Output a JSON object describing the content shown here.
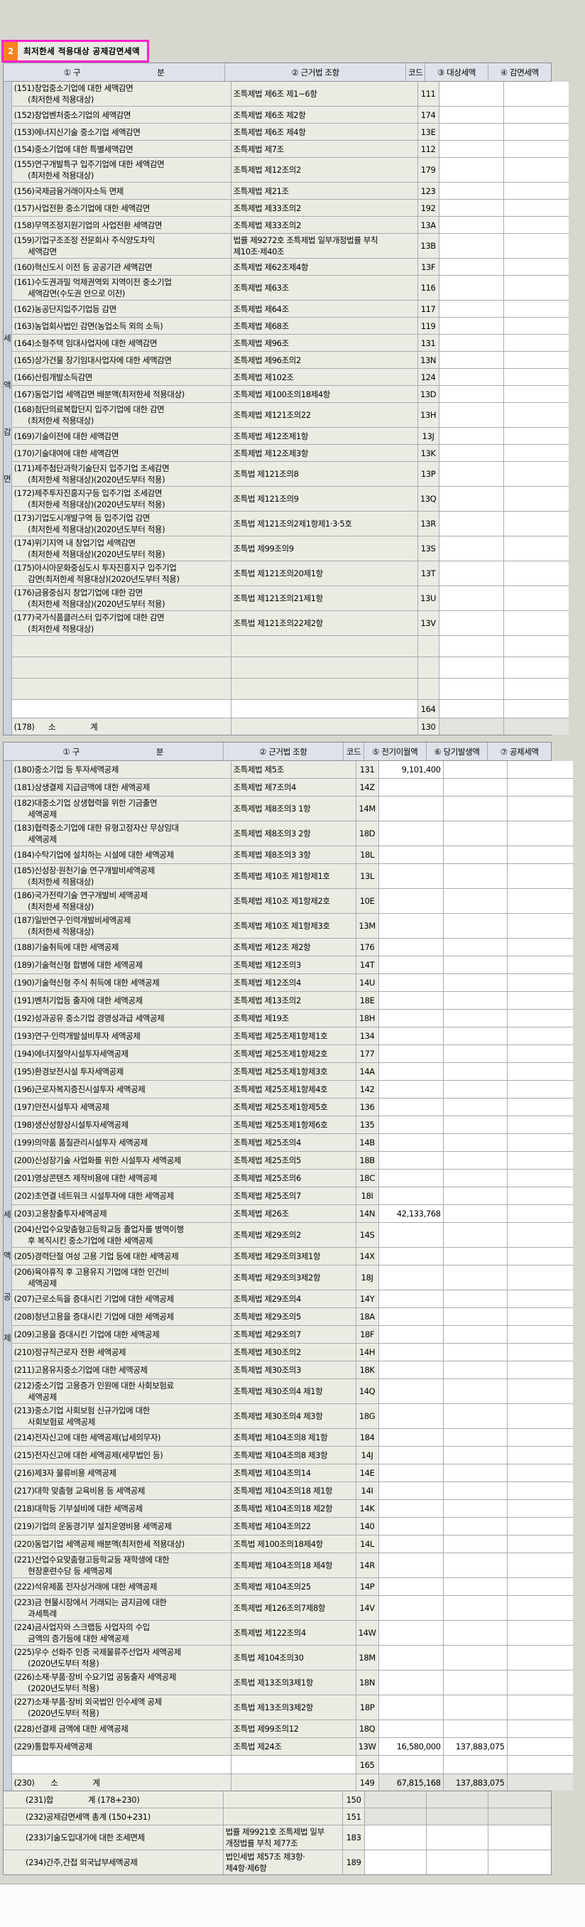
{
  "title": {
    "number": "2",
    "text": "최저한세 적용대상 공제감면세액"
  },
  "table1": {
    "side_label": "세액감면",
    "headers": {
      "col1_left": "① 구",
      "col1_right": "분",
      "col2": "② 근거법 조항",
      "code": "코드",
      "v1": "③ 대상세액",
      "v2": "④ 감면세액"
    },
    "rows": [
      {
        "label": "(151)창업중소기업에 대한 세액감면\n      (최저한세 적용대상)",
        "basis": "조특제법 제6조 제1~6항",
        "code": "111",
        "h2": true
      },
      {
        "label": "(152)창업벤처중소기업의 세액감면",
        "basis": "조특제법 제6조 제2항",
        "code": "174"
      },
      {
        "label": "(153)에너지신기술 중소기업 세액감면",
        "basis": "조특제법 제6조 제4항",
        "code": "13E"
      },
      {
        "label": "(154)중소기업에 대한 특별세액감면",
        "basis": "조특제법 제7조",
        "code": "112"
      },
      {
        "label": "(155)연구개발특구 입주기업에 대한 세액감면\n      (최저한세 적용대상)",
        "basis": "조특제법 제12조의2",
        "code": "179",
        "h2": true
      },
      {
        "label": "(156)국제금융거래이자소득 면제",
        "basis": "조특제법 제21조",
        "code": "123"
      },
      {
        "label": "(157)사업전환 중소기업에 대한 세액감면",
        "basis": "조특제법 제33조의2",
        "code": "192"
      },
      {
        "label": "(158)무역조정지원기업의 사업전환 세액감면",
        "basis": "조특제법 제33조의2",
        "code": "13A"
      },
      {
        "label": "(159)기업구조조정 전문회사 주식양도차익\n      세액감면",
        "basis": "법률 제9272호 조특제법 일부개정법률 부칙\n제10조·제40조",
        "code": "13B",
        "h2": true
      },
      {
        "label": "(160)혁신도시 이전 등 공공기관 세액감면",
        "basis": "조특제법 제62조제4항",
        "code": "13F"
      },
      {
        "label": "(161)수도권과밀 억제권역외 지역이전 중소기업\n      세액감면(수도권 안으로 이전)",
        "basis": "조특제법 제63조",
        "code": "116",
        "h2": true
      },
      {
        "label": "(162)농공단지입주기업등 감면",
        "basis": "조특제법 제64조",
        "code": "117"
      },
      {
        "label": "(163)농업회사법인 감면(농업소득 외의 소득)",
        "basis": "조특제법 제68조",
        "code": "119"
      },
      {
        "label": "(164)소형주택 임대사업자에 대한 세액감면",
        "basis": "조특제법 제96조",
        "code": "131"
      },
      {
        "label": "(165)상가건물 장기임대사업자에 대한 세액감면",
        "basis": "조특제법 제96조의2",
        "code": "13N"
      },
      {
        "label": "(166)산림개발소득감면",
        "basis": "조특제법 제102조",
        "code": "124"
      },
      {
        "label": "(167)동업기업 세액감면 배분액(최저한세 적용대상)",
        "basis": "조특제법 제100조의18제4항",
        "code": "13D"
      },
      {
        "label": "(168)첨단의료복합단지 입주기업에 대한 감면\n      (최저한세 적용대상)",
        "basis": "조특제법 제121조의22",
        "code": "13H",
        "h2": true
      },
      {
        "label": "(169)기술이전에 대한 세액감면",
        "basis": "조특제법 제12조제1항",
        "code": "13J"
      },
      {
        "label": "(170)기술대여에 대한 세액감면",
        "basis": "조특제법 제12조제3항",
        "code": "13K"
      },
      {
        "label": "(171)제주첨단과학기술단지 입주기업 조세감면\n      (최저한세 적용대상)(2020년도부터 적용)",
        "basis": "조특법 제121조의8",
        "code": "13P",
        "h2": true
      },
      {
        "label": "(172)제주투자진흥지구등 입주기업 조세감면\n      (최저한세 적용대상)(2020년도부터 적용)",
        "basis": "조특법 제121조의9",
        "code": "13Q",
        "h2": true
      },
      {
        "label": "(173)기업도시개발구역 등 입주기업 감면\n      (최저한세 적용대상)(2020년도부터 적용)",
        "basis": "조특법 제121조의2제1항제1·3·5호",
        "code": "13R",
        "h2": true
      },
      {
        "label": "(174)위기지역 내 창업기업 세액감면\n      (최저한세 적용대상)(2020년도부터 적용)",
        "basis": "조특법 제99조의9",
        "code": "13S",
        "h2": true
      },
      {
        "label": "(175)아시아문화중심도시 투자진흥지구 입주기업\n      감면(최저한세 적용대상)(2020년도부터 적용)",
        "basis": "조특법 제121조의20제1항",
        "code": "13T",
        "h2": true
      },
      {
        "label": "(176)금융중심지 창업기업에 대한 감면\n      (최저한세 적용대상)(2020년도부터 적용)",
        "basis": "조특법 제121조의21제1항",
        "code": "13U",
        "h2": true
      },
      {
        "label": "(177)국가식품클러스터 입주기업에 대한 감면\n      (최저한세 적용대상)",
        "basis": "조특법 제121조의22제2항",
        "code": "13V",
        "h2": true
      },
      {
        "type": "spacer"
      },
      {
        "type": "spacer"
      },
      {
        "type": "spacer"
      },
      {
        "type": "code_only",
        "code": "164"
      },
      {
        "type": "subtotal",
        "label": "(178)      소               계",
        "code": "130"
      }
    ]
  },
  "table2": {
    "side_label": "세액공제",
    "headers": {
      "col1_left": "① 구",
      "col1_right": "분",
      "col2": "② 근거법 조항",
      "code": "코드",
      "v1": "⑤ 전기이월액",
      "v2": "⑥ 당기발생액",
      "v3": "⑦ 공제세액"
    },
    "rows": [
      {
        "label": "(180)중소기업 등 투자세액공제",
        "basis": "조특제법 제5조",
        "code": "131",
        "v1": "9,101,400"
      },
      {
        "label": "(181)상생결제 지급금액에 대한 세액공제",
        "basis": "조특제법 제7조의4",
        "code": "14Z"
      },
      {
        "label": "(182)대중소기업 상생협력을 위한 기금출연\n      세액공제",
        "basis": "조특제법 제8조의3 1항",
        "code": "14M",
        "h2": true
      },
      {
        "label": "(183)협력중소기업에 대한 유형고정자산 무상임대\n      세액공제",
        "basis": "조특제법 제8조의3 2항",
        "code": "18D",
        "h2": true
      },
      {
        "label": "(184)수탁기업에 설치하는 시설에 대한 세액공제",
        "basis": "조특제법 제8조의3 3항",
        "code": "18L"
      },
      {
        "label": "(185)신성장·원천기술 연구개발비세액공제\n      (최저한세 적용대상)",
        "basis": "조특제법 제10조 제1항제1호",
        "code": "13L",
        "h2": true
      },
      {
        "label": "(186)국가전략기술 연구개발비 세액공제\n      (최저한세 적용대상)",
        "basis": "조특제법 제10조 제1항제2호",
        "code": "10E",
        "h2": true
      },
      {
        "label": "(187)일반연구·인력개발비세액공제\n      (최저한세 적용대상)",
        "basis": "조특제법 제10조 제1항제3호",
        "code": "13M",
        "h2": true
      },
      {
        "label": "(188)기술취득에 대한 세액공제",
        "basis": "조특제법 제12조 제2항",
        "code": "176"
      },
      {
        "label": "(189)기술혁신형 합병에 대한 세액공제",
        "basis": "조특제법 제12조의3",
        "code": "14T"
      },
      {
        "label": "(190)기술혁신형 주식 취득에 대한 세액공제",
        "basis": "조특제법 제12조의4",
        "code": "14U"
      },
      {
        "label": "(191)벤처기업등 출자에 대한 세액공제",
        "basis": "조특제법 제13조의2",
        "code": "18E"
      },
      {
        "label": "(192)성과공유 중소기업 경영성과급 세액공제",
        "basis": "조특제법 제19조",
        "code": "18H"
      },
      {
        "label": "(193)연구·인력개발설비투자 세액공제",
        "basis": "조특제법 제25조제1항제1호",
        "code": "134"
      },
      {
        "label": "(194)에너지절약시설투자세액공제",
        "basis": "조특제법 제25조제1항제2호",
        "code": "177"
      },
      {
        "label": "(195)환경보전시설 투자세액공제",
        "basis": "조특제법 제25조제1항제3호",
        "code": "14A"
      },
      {
        "label": "(196)근로자복지증진시설투자 세액공제",
        "basis": "조특제법 제25조제1항제4호",
        "code": "142"
      },
      {
        "label": "(197)안전시설투자 세액공제",
        "basis": "조특제법 제25조제1항제5호",
        "code": "136"
      },
      {
        "label": "(198)생산성향상시설투자세액공제",
        "basis": "조특제법 제25조제1항제6호",
        "code": "135"
      },
      {
        "label": "(199)의약품 품질관리시설투자 세액공제",
        "basis": "조특제법 제25조의4",
        "code": "14B"
      },
      {
        "label": "(200)신성장기술 사업화를 위한 시설투자 세액공제",
        "basis": "조특제법 제25조의5",
        "code": "18B"
      },
      {
        "label": "(201)영상콘텐츠 제작비용에 대한 세액공제",
        "basis": "조특제법 제25조의6",
        "code": "18C"
      },
      {
        "label": "(202)초연결 네트워크 시설투자에 대한 세액공제",
        "basis": "조특제법 제25조의7",
        "code": "18I"
      },
      {
        "label": "(203)고용창출투자세액공제",
        "basis": "조특제법 제26조",
        "code": "14N",
        "v1": "42,133,768"
      },
      {
        "label": "(204)산업수요맞춤형고등학교등 졸업자를 병역이행\n      후 복직시킨 중소기업에 대한 세액공제",
        "basis": "조특제법 제29조의2",
        "code": "14S",
        "h2": true
      },
      {
        "label": "(205)경력단절 여성 고용 기업 등에 대한 세액공제",
        "basis": "조특제법 제29조의3제1항",
        "code": "14X"
      },
      {
        "label": "(206)육아휴직 후 고용유지 기업에 대한 인건비\n      세액공제",
        "basis": "조특제법 제29조의3제2항",
        "code": "18J",
        "h2": true
      },
      {
        "label": "(207)근로소득을 증대시킨 기업에 대한 세액공제",
        "basis": "조특제법 제29조의4",
        "code": "14Y"
      },
      {
        "label": "(208)청년고용을 증대시킨 기업에 대한 세액공제",
        "basis": "조특제법 제29조의5",
        "code": "18A"
      },
      {
        "label": "(209)고용을 증대시킨 기업에 대한 세액공제",
        "basis": "조특제법 제29조의7",
        "code": "18F"
      },
      {
        "label": "(210)정규직근로자 전환 세액공제",
        "basis": "조특제법 제30조의2",
        "code": "14H"
      },
      {
        "label": "(211)고용유지중소기업에 대한 세액공제",
        "basis": "조특제법 제30조의3",
        "code": "18K"
      },
      {
        "label": "(212)중소기업 고용증가 인원에 대한 사회보험료\n      세액공제",
        "basis": "조특제법 제30조의4 제1항",
        "code": "14Q",
        "h2": true
      },
      {
        "label": "(213)중소기업 사회보험 신규가입에 대한\n      사회보험료 세액공제",
        "basis": "조특제법 제30조의4 제3항",
        "code": "18G",
        "h2": true
      },
      {
        "label": "(214)전자신고에 대한 세액공제(납세의무자)",
        "basis": "조특제법 제104조의8 제1항",
        "code": "184"
      },
      {
        "label": "(215)전자신고에 대한 세액공제(세무법인 등)",
        "basis": "조특제법 제104조의8 제3항",
        "code": "14J"
      },
      {
        "label": "(216)제3자 물류비용 세액공제",
        "basis": "조특제법 제104조의14",
        "code": "14E"
      },
      {
        "label": "(217)대학 맞춤형 교육비용 등 세액공제",
        "basis": "조특제법 제104조의18 제1항",
        "code": "14I"
      },
      {
        "label": "(218)대학등 기부설비에 대한 세액공제",
        "basis": "조특제법 제104조의18 제2항",
        "code": "14K"
      },
      {
        "label": "(219)기업의 운동경기부 설치운영비용 세액공제",
        "basis": "조특제법 제104조의22",
        "code": "140"
      },
      {
        "label": "(220)동업기업 세액공제 배분액(최저한세 적용대상)",
        "basis": "조특법 제100조의18제4항",
        "code": "14L"
      },
      {
        "label": "(221)산업수요맞춤형고등학교등 재학생에 대한\n      현장훈련수당 등 세액공제",
        "basis": "조특제법 제104조의18 제4항",
        "code": "14R",
        "h2": true
      },
      {
        "label": "(222)석유제품 전자상거래에 대한 세액공제",
        "basis": "조특제법 제104조의25",
        "code": "14P"
      },
      {
        "label": "(223)금 현물시장에서 거래되는 금지금에 대한\n      과세특례",
        "basis": "조특제법 제126조의7제8항",
        "code": "14V",
        "h2": true
      },
      {
        "label": "(224)금사업자와 스크랩등 사업자의 수입\n      금액의 증가등에 대한 세액공제",
        "basis": "조특제법 제122조의4",
        "code": "14W",
        "h2": true
      },
      {
        "label": "(225)우수 선화주 인증 국제물류주선업자 세액공제\n      (2020년도부터 적용)",
        "basis": "조특법 제104조의30",
        "code": "18M",
        "h2": true
      },
      {
        "label": "(226)소재·부품·장비 수요기업 공동출자 세액공제\n      (2020년도부터 적용)",
        "basis": "조특법 제13조의3제1항",
        "code": "18N",
        "h2": true
      },
      {
        "label": "(227)소재·부품·장비 외국법인 인수세액 공제\n      (2020년도부터 적용)",
        "basis": "조특법 제13조의3제2항",
        "code": "18P",
        "h2": true
      },
      {
        "label": "(228)선결제 금액에 대한 세액공제",
        "basis": "조특법 제99조의12",
        "code": "18Q"
      },
      {
        "label": "(229)통합투자세액공제",
        "basis": "조특법 제24조",
        "code": "13W",
        "v1": "16,580,000",
        "v2": "137,883,075"
      },
      {
        "type": "code_only",
        "code": "165"
      },
      {
        "type": "subtotal",
        "label": "(230)       소               계",
        "code": "149",
        "v1": "67,815,168",
        "v2": "137,883,075"
      }
    ]
  },
  "footer": {
    "rows": [
      {
        "label": "(231)합               계 (178+230)",
        "basis": "",
        "code": "150",
        "shaded": true
      },
      {
        "label": "(232)공제감면세액 총계 (150+231)",
        "basis": "",
        "code": "151",
        "shaded": true
      },
      {
        "label": "(233)기술도입대가에 대한 조세면제",
        "basis": "법률 제9921호 조특제법 일부\n개정법률 부칙 제77조",
        "code": "183",
        "h2": true
      },
      {
        "label": "(234)간주,간접 외국납부세액공제",
        "basis": "법인세법 제57조 제3항·\n제4항·제6항",
        "code": "189",
        "h2": true
      }
    ]
  }
}
